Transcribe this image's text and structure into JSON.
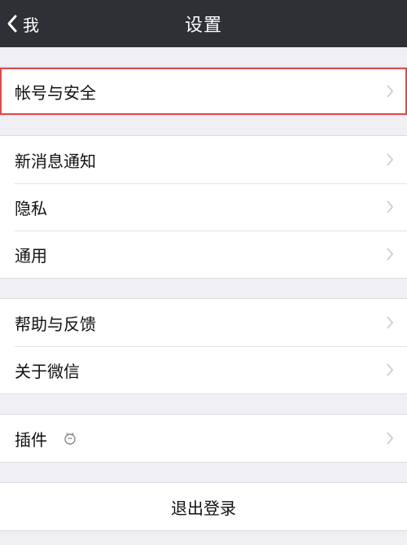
{
  "navbar": {
    "back_label": "我",
    "title": "设置"
  },
  "groups": {
    "account": {
      "items": [
        {
          "label": "帐号与安全"
        }
      ]
    },
    "general": {
      "items": [
        {
          "label": "新消息通知"
        },
        {
          "label": "隐私"
        },
        {
          "label": "通用"
        }
      ]
    },
    "help": {
      "items": [
        {
          "label": "帮助与反馈"
        },
        {
          "label": "关于微信"
        }
      ]
    },
    "plugins": {
      "items": [
        {
          "label": "插件",
          "icon": "plugin-badge-icon"
        }
      ]
    }
  },
  "logout": {
    "label": "退出登录"
  },
  "colors": {
    "navbar": "#2f3035",
    "background": "#efeff4",
    "highlight_outline": "#e04a4a",
    "chevron": "#c7c7cc"
  }
}
